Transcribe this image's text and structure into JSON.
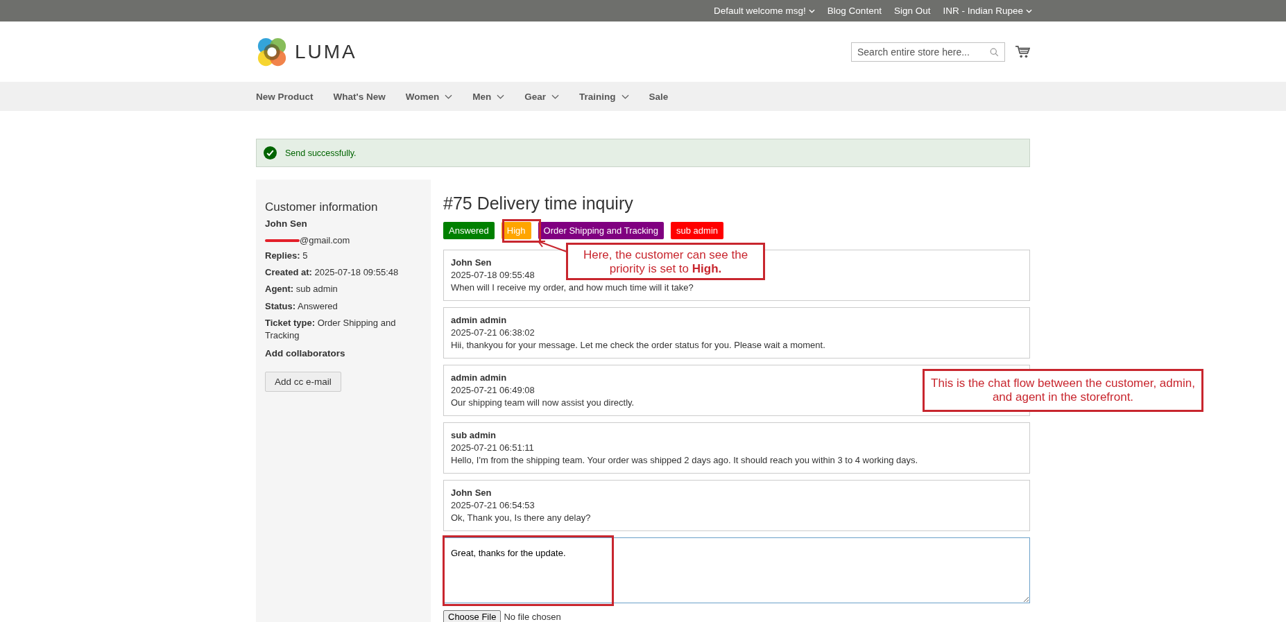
{
  "top_links": [
    {
      "label": "Default welcome msg!",
      "dropdown": true
    },
    {
      "label": "Blog Content",
      "dropdown": false
    },
    {
      "label": "Sign Out",
      "dropdown": false
    },
    {
      "label": "INR - Indian Rupee",
      "dropdown": true
    }
  ],
  "logo": {
    "text": "LUMA"
  },
  "search": {
    "placeholder": "Search entire store here..."
  },
  "nav": [
    {
      "label": "New Product",
      "dropdown": false
    },
    {
      "label": "What's New",
      "dropdown": false
    },
    {
      "label": "Women",
      "dropdown": true
    },
    {
      "label": "Men",
      "dropdown": true
    },
    {
      "label": "Gear",
      "dropdown": true
    },
    {
      "label": "Training",
      "dropdown": true
    },
    {
      "label": "Sale",
      "dropdown": false
    }
  ],
  "success_message": "Send successfully.",
  "sidebar": {
    "title": "Customer information",
    "name": "John Sen",
    "email": "@gmail.com",
    "email_redacted": true,
    "fields": [
      {
        "label": "Replies:",
        "value": "5"
      },
      {
        "label": "Created at:",
        "value": "2025-07-18 09:55:48"
      },
      {
        "label": "Agent:",
        "value": "sub admin"
      },
      {
        "label": "Status:",
        "value": "Answered"
      },
      {
        "label": "Ticket type:",
        "value": "Order Shipping and Tracking"
      }
    ],
    "collaborators_title": "Add collaborators",
    "add_button": "Add cc e-mail"
  },
  "ticket": {
    "title": "#75 Delivery time inquiry",
    "badges": [
      {
        "label": "Answered",
        "color": "#008000"
      },
      {
        "label": "High",
        "color": "#ffa500"
      },
      {
        "label": "Order Shipping and Tracking",
        "color": "#800080"
      },
      {
        "label": "sub admin",
        "color": "#ff0000"
      }
    ],
    "messages": [
      {
        "author": "John Sen",
        "time": "2025-07-18 09:55:48",
        "text": "When will I receive my order, and how much time will it take?"
      },
      {
        "author": "admin admin",
        "time": "2025-07-21 06:38:02",
        "text": "Hii, thankyou for your message. Let me check the order status for you. Please wait a moment."
      },
      {
        "author": "admin admin",
        "time": "2025-07-21 06:49:08",
        "text": "Our shipping team will now assist you directly."
      },
      {
        "author": "sub admin",
        "time": "2025-07-21 06:51:11",
        "text": "Hello, I'm from the shipping team. Your order was shipped 2 days ago. It should reach you within 3 to 4 working days."
      },
      {
        "author": "John Sen",
        "time": "2025-07-21 06:54:53",
        "text": "Ok, Thank you, Is there any delay?"
      }
    ],
    "reply": "Great, thanks for the update.",
    "file_button": "Choose File",
    "file_status": "No file chosen"
  },
  "annotations": [
    {
      "kind": "badge_callout",
      "text": "Here, the customer can see the priority is set to **High.**"
    },
    {
      "kind": "callout",
      "text": "This is the chat flow between the customer, admin, and agent in the storefront."
    },
    {
      "kind": "reply_frame"
    }
  ]
}
